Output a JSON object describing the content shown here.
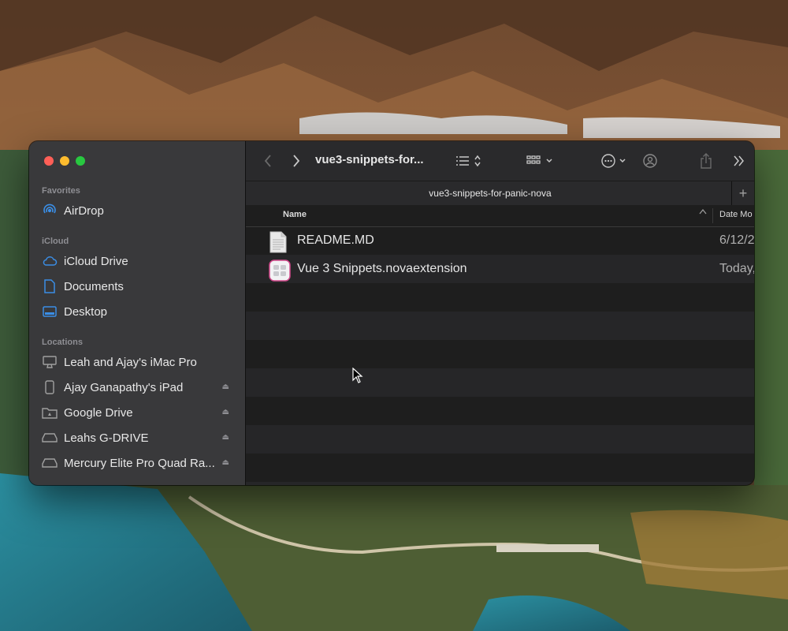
{
  "window": {
    "title": "vue3-snippets-for...",
    "tab_label": "vue3-snippets-for-panic-nova",
    "tab_add": "+"
  },
  "sidebar": {
    "sections": [
      {
        "heading": "Favorites",
        "items": [
          {
            "label": "AirDrop",
            "icon": "airdrop-icon"
          }
        ]
      },
      {
        "heading": "iCloud",
        "items": [
          {
            "label": "iCloud Drive",
            "icon": "cloud-icon"
          },
          {
            "label": "Documents",
            "icon": "document-icon"
          },
          {
            "label": "Desktop",
            "icon": "desktop-icon"
          }
        ]
      },
      {
        "heading": "Locations",
        "items": [
          {
            "label": "Leah and Ajay's iMac Pro",
            "icon": "imac-icon"
          },
          {
            "label": "Ajay Ganapathy's iPad",
            "icon": "ipad-icon",
            "eject": true
          },
          {
            "label": "Google Drive",
            "icon": "drive-folder-icon",
            "eject": true
          },
          {
            "label": "Leahs G-DRIVE",
            "icon": "external-drive-icon",
            "eject": true
          },
          {
            "label": "Mercury Elite Pro Quad Ra...",
            "icon": "external-drive-icon",
            "eject": true
          }
        ]
      }
    ]
  },
  "columns": {
    "name": "Name",
    "date": "Date Mo"
  },
  "files": [
    {
      "name": "README.MD",
      "date": "6/12/2",
      "icon": "text-file-icon"
    },
    {
      "name": "Vue 3 Snippets.novaextension",
      "date": "Today,",
      "icon": "nova-extension-icon"
    }
  ],
  "colors": {
    "close": "#ff5f57",
    "minimize": "#febc2e",
    "maximize": "#28c840",
    "accent": "#3a8ee6"
  }
}
